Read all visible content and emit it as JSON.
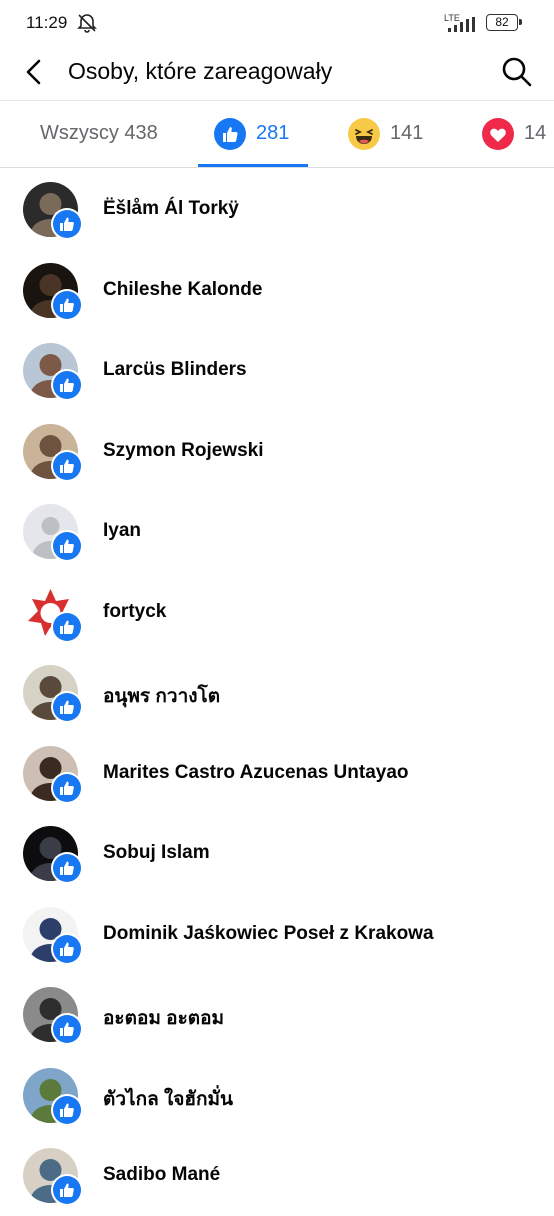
{
  "status_bar": {
    "time": "11:29",
    "network": "LTE",
    "battery": "82"
  },
  "header": {
    "title": "Osoby, które zareagowały",
    "back_icon": "back-arrow-icon",
    "search_icon": "search-icon"
  },
  "tabs": [
    {
      "label": "Wszyscy 438",
      "icon": ""
    },
    {
      "label": "281",
      "icon": "like-icon"
    },
    {
      "label": "141",
      "icon": "haha-icon"
    },
    {
      "label": "14",
      "icon": "love-icon"
    }
  ],
  "colors": {
    "accent": "#1877f2",
    "muted": "#65676b",
    "divider": "#dadde1"
  },
  "people": [
    {
      "name": "Ëšlåm Ál Torkÿ",
      "avatar_colors": [
        "#2b2b2b",
        "#7a6a5a"
      ]
    },
    {
      "name": "Chileshe Kalonde",
      "avatar_colors": [
        "#1a1410",
        "#4a3426"
      ]
    },
    {
      "name": "Larcüs Blinders",
      "avatar_colors": [
        "#b8c6d6",
        "#7d5a47"
      ]
    },
    {
      "name": "Szymon Rojewski",
      "avatar_colors": [
        "#c9b49a",
        "#6e5440"
      ]
    },
    {
      "name": "Iyan",
      "avatar_colors": [
        "#e4e6eb",
        "#bcc0c4"
      ]
    },
    {
      "name": "fortyck",
      "avatar_colors": [
        "#ffffff",
        "#d8302f"
      ]
    },
    {
      "name": "อนุพร กวางโต",
      "avatar_colors": [
        "#d7d2c6",
        "#5a4a3c"
      ]
    },
    {
      "name": "Marites Castro Azucenas Untayao",
      "avatar_colors": [
        "#cdbfb3",
        "#3a2a22"
      ]
    },
    {
      "name": "Sobuj Islam",
      "avatar_colors": [
        "#0d0d10",
        "#3a3d48"
      ]
    },
    {
      "name": "Dominik Jaśkowiec Poseł z Krakowa",
      "avatar_colors": [
        "#f3f3f3",
        "#2c3f6b"
      ]
    },
    {
      "name": "อะตอม อะตอม",
      "avatar_colors": [
        "#8a8a8a",
        "#2e2e2e"
      ]
    },
    {
      "name": "ตัวไกล ใจฮักมั่น",
      "avatar_colors": [
        "#7fa6c9",
        "#5c7a3b"
      ]
    },
    {
      "name": "Sadibo Mané",
      "avatar_colors": [
        "#d8d0c4",
        "#4b6b87"
      ]
    }
  ]
}
